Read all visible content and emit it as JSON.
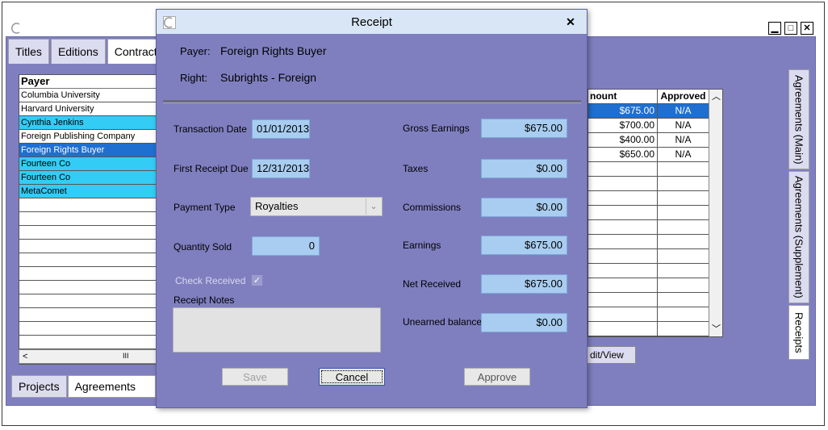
{
  "app": {
    "top_tabs": [
      "Titles",
      "Editions",
      "Contract T"
    ],
    "bottom_tabs": [
      "Projects",
      "Agreements"
    ],
    "payer_header": "Payer",
    "payers": [
      {
        "name": "Columbia University",
        "state": "normal"
      },
      {
        "name": "Harvard University",
        "state": "normal"
      },
      {
        "name": "Cynthia Jenkins",
        "state": "highlight"
      },
      {
        "name": "Foreign Publishing Company",
        "state": "normal"
      },
      {
        "name": "Foreign Rights Buyer",
        "state": "selected"
      },
      {
        "name": "Fourteen Co",
        "state": "highlight"
      },
      {
        "name": "Fourteen Co",
        "state": "highlight"
      },
      {
        "name": "MetaComet",
        "state": "highlight"
      }
    ],
    "hscroll_glyph": "III",
    "receipts_table": {
      "headers": {
        "amount": "nount",
        "approved": "Approved"
      },
      "rows": [
        {
          "amount": "$675.00",
          "approved": "N/A"
        },
        {
          "amount": "$700.00",
          "approved": "N/A"
        },
        {
          "amount": "$400.00",
          "approved": "N/A"
        },
        {
          "amount": "$650.00",
          "approved": "N/A"
        }
      ]
    },
    "edit_view_label": "dit/View",
    "side_tabs": [
      "Agreements (Main)",
      "Agreements (Supplement)",
      "Receipts"
    ]
  },
  "dialog": {
    "title": "Receipt",
    "payer_label": "Payer:",
    "payer_value": "Foreign Rights Buyer",
    "right_label": "Right:",
    "right_value": "Subrights - Foreign",
    "fields": {
      "transaction_date_label": "Transaction Date",
      "transaction_date": "01/01/2013",
      "first_receipt_due_label": "First Receipt Due",
      "first_receipt_due": "12/31/2013",
      "payment_type_label": "Payment Type",
      "payment_type": "Royalties",
      "quantity_sold_label": "Quantity Sold",
      "quantity_sold": "0",
      "check_received_label": "Check Received",
      "receipt_notes_label": "Receipt Notes",
      "gross_earnings_label": "Gross Earnings",
      "gross_earnings": "$675.00",
      "taxes_label": "Taxes",
      "taxes": "$0.00",
      "commissions_label": "Commissions",
      "commissions": "$0.00",
      "earnings_label": "Earnings",
      "earnings": "$675.00",
      "net_received_label": "Net Received",
      "net_received": "$675.00",
      "unearned_balance_label": "Unearned balance",
      "unearned_balance": "$0.00"
    },
    "buttons": {
      "save": "Save",
      "cancel": "Cancel",
      "approve": "Approve"
    }
  },
  "colors": {
    "panel": "#7f7fc0",
    "field": "#a8cdf0",
    "selected": "#1e6fd0",
    "highlight": "#33ccf5"
  }
}
